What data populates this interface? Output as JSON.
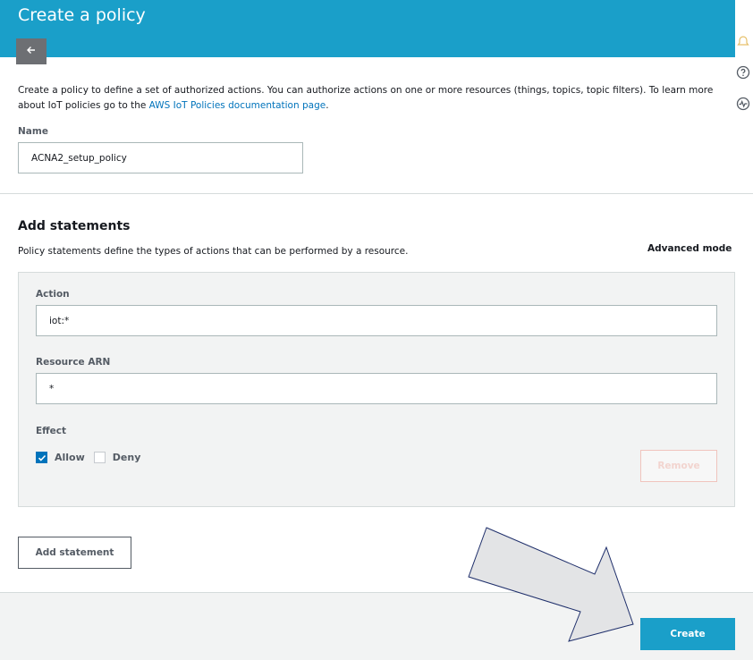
{
  "header": {
    "title": "Create a policy",
    "back_icon": "arrow-left-icon",
    "color": "#1a9fc9"
  },
  "rail": {
    "icons": [
      "notification-bell-icon",
      "help-icon",
      "activity-icon"
    ]
  },
  "intro": {
    "text": "Create a policy to define a set of authorized actions. You can authorize actions on one or more resources (things, topics, topic filters). To learn more about IoT policies go to the ",
    "link": "AWS IoT Policies documentation page",
    "suffix": "."
  },
  "name_field": {
    "label": "Name",
    "value": "ACNA2_setup_policy"
  },
  "statements": {
    "title": "Add statements",
    "description": "Policy statements define the types of actions that can be performed by a resource.",
    "advanced_mode": "Advanced mode",
    "action_label": "Action",
    "action_value": "iot:*",
    "resource_label": "Resource ARN",
    "resource_value": "*",
    "effect_label": "Effect",
    "allow_label": "Allow",
    "allow_checked": true,
    "deny_label": "Deny",
    "deny_checked": false,
    "remove_label": "Remove"
  },
  "add_statement_label": "Add statement",
  "footer": {
    "create_label": "Create"
  },
  "annotation": {
    "type": "arrow-pointing-to-create-button",
    "fill": "#e3e4e6",
    "stroke": "#1f2f6b"
  }
}
